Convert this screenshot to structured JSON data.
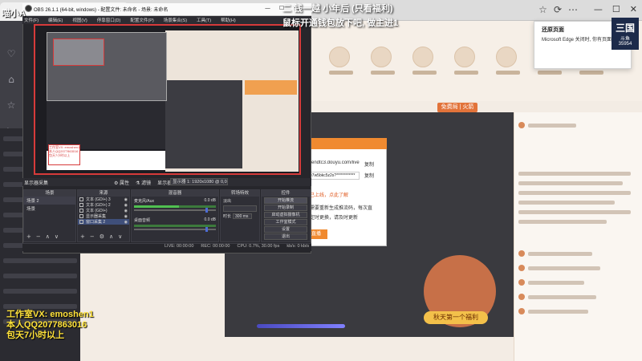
{
  "obs": {
    "title": "OBS 26.1.1 (64-bit, windows) - 配置文件: 未命名 - 场景: 未命名",
    "menus": [
      "文件(F)",
      "编辑(E)",
      "视图(V)",
      "停靠窗口(D)",
      "配置文件(P)",
      "场景集合(S)",
      "工具(T)",
      "帮助(H)"
    ],
    "window_controls": [
      "—",
      "☐",
      "✕"
    ],
    "scene_bar": {
      "label": "显示器采集",
      "properties": "⚙ 属性",
      "filters": "⚗ 滤镜",
      "display_label": "显示器",
      "resolution": "显示器 1: 1920x1080 @ 0,0"
    },
    "preview_caption": [
      "工作室VX: emoshen1",
      "本人QQ2077863016",
      "包天7小时以上"
    ],
    "docks": {
      "scenes": {
        "title": "场景",
        "items": [
          "场景 2",
          "场景"
        ]
      },
      "sources": {
        "title": "来源",
        "items": [
          "文本 (GDI+) 3",
          "文本 (GDI+) 2",
          "文本 (GDI+)",
          "显示器采集",
          "窗口采集 2"
        ]
      },
      "mixer": {
        "title": "混音器",
        "channels": [
          {
            "name": "麦克风/Aux",
            "db": "0.0 dB",
            "level": 0.55,
            "volume": 0.9
          },
          {
            "name": "桌面音频",
            "db": "0.0 dB",
            "level": 0.0,
            "volume": 0.9
          }
        ]
      },
      "transitions": {
        "title": "转场特效",
        "type": "淡出",
        "duration_label": "时长",
        "duration": "300 ms"
      },
      "controls": {
        "title": "控件",
        "buttons": [
          "开始推流",
          "开始录制",
          "启动虚拟摄像机",
          "工作室模式",
          "设置",
          "退出"
        ]
      },
      "footer_buttons": [
        "+",
        "−",
        "∧",
        "∨"
      ],
      "source_footer": [
        "+",
        "−",
        "⚙",
        "∧",
        "∨"
      ]
    },
    "status": {
      "live": "LIVE: 00:00:00",
      "rec": "REC: 00:00:00",
      "cpu": "CPU: 0.7%, 30.00 fps",
      "kbps": "kb/s: 0 kb/s"
    }
  },
  "browser": {
    "window_controls": [
      "—",
      "☐",
      "✕"
    ],
    "tabbar_icons": [
      "☆",
      "⟳",
      "⋯"
    ]
  },
  "notification": {
    "title": "还原页面",
    "text": "Microsoft Edge 关闭时, 你有页面",
    "close": "✕",
    "logo_text": "三国",
    "logo_subtitle": "斗鱼",
    "count": "35954"
  },
  "dialog": {
    "url": "rtmp://sendtc3.douyu.com/live",
    "copy_1": "复制",
    "key": "5kr1tlbe7w5bkc5z2s?************",
    "copy_2": "复制",
    "tip_1": "推流码已上线，点此了解",
    "tip_2": "直播间需要重新生成推流码，每次直",
    "tip_3": "播码会定时更换，请及时更新",
    "button": "开始直播"
  },
  "site": {
    "player_tag": "免费局 | 火箭",
    "red_packet": "秋天第一个福利",
    "nav_count": 7
  },
  "overlays": {
    "top_left": "喵小A",
    "top_center": "二 钱一越 小年后 (只看福利)",
    "top_center_2": "鼠标开通钱包放下吧, 做主进1",
    "bottom_left": [
      "工作室VX: emoshen1",
      "本人QQ2077863016",
      "包天7小时以上"
    ]
  },
  "colors": {
    "obs_bg": "#26262b",
    "preview_border": "#d63a3a",
    "accent_orange": "#f08a30",
    "overlay_yellow": "#ffe23a"
  }
}
